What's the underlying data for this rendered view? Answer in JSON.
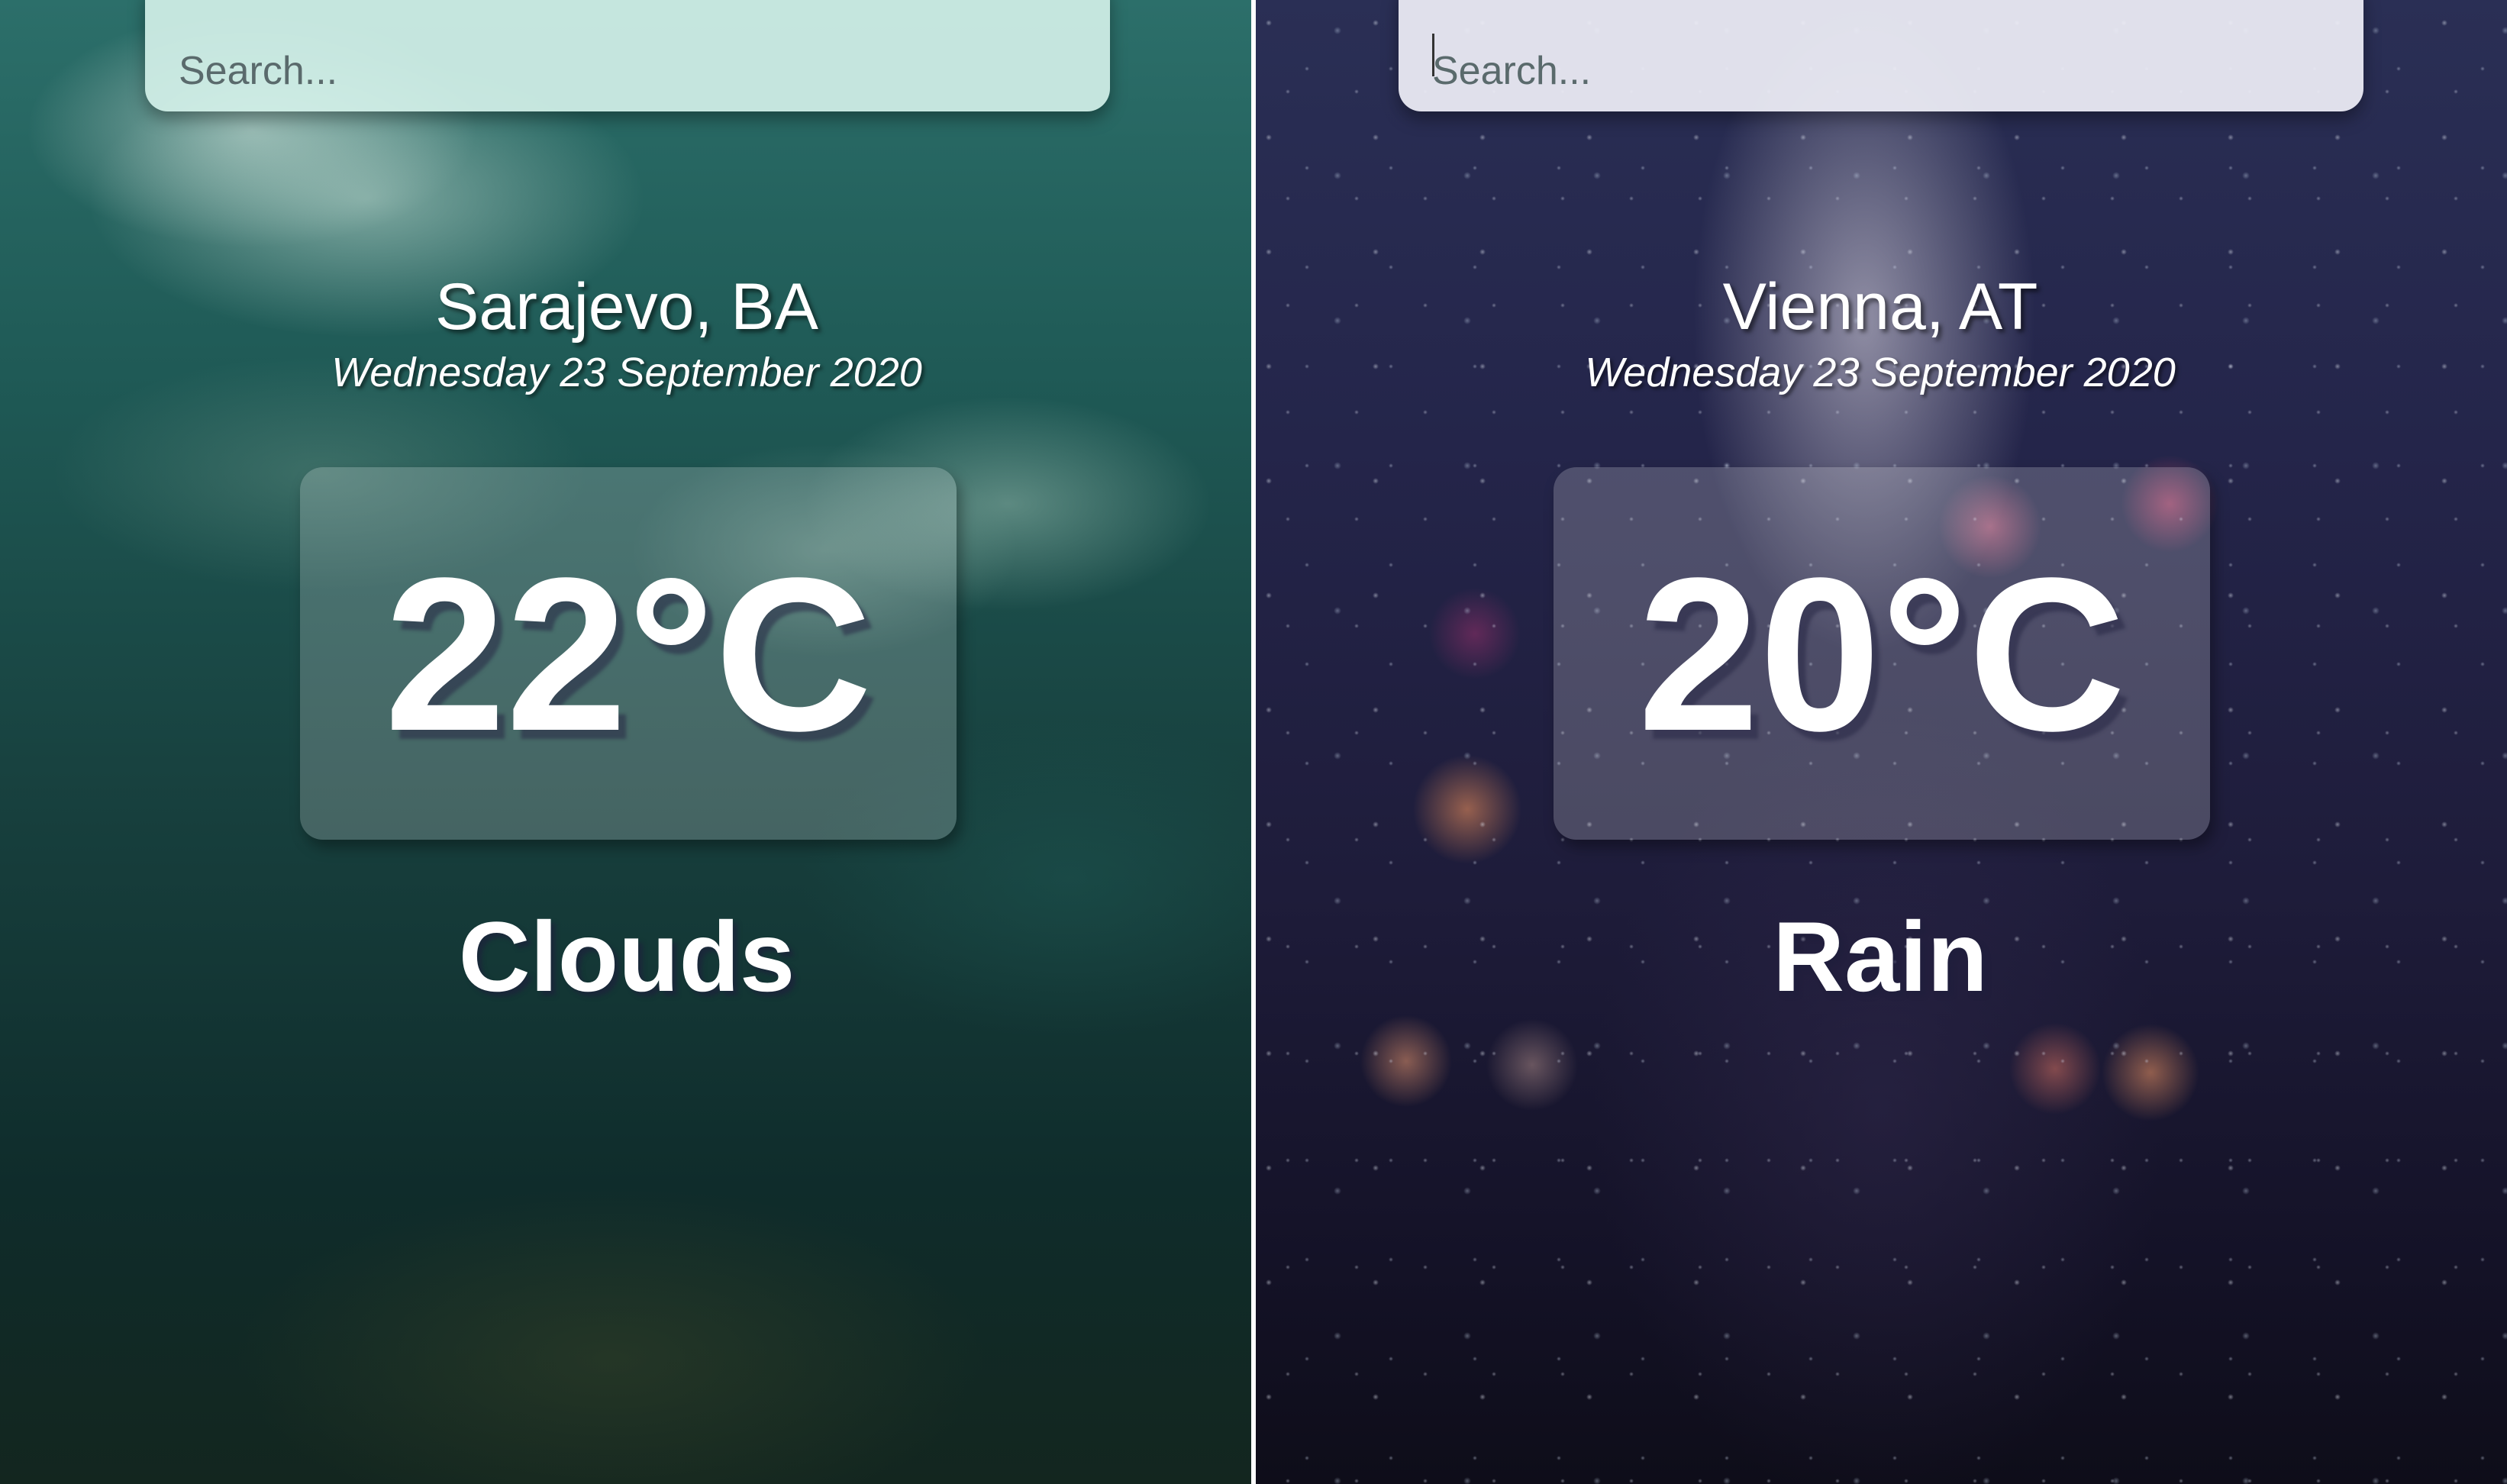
{
  "panels": [
    {
      "search": {
        "placeholder": "Search..."
      },
      "location": "Sarajevo, BA",
      "date": "Wednesday 23 September 2020",
      "temperature": "22°C",
      "condition": "Clouds",
      "theme_color": "#1f5a56"
    },
    {
      "search": {
        "placeholder": "Search..."
      },
      "location": "Vienna, AT",
      "date": "Wednesday 23 September 2020",
      "temperature": "20°C",
      "condition": "Rain",
      "theme_color": "#24254a"
    }
  ]
}
